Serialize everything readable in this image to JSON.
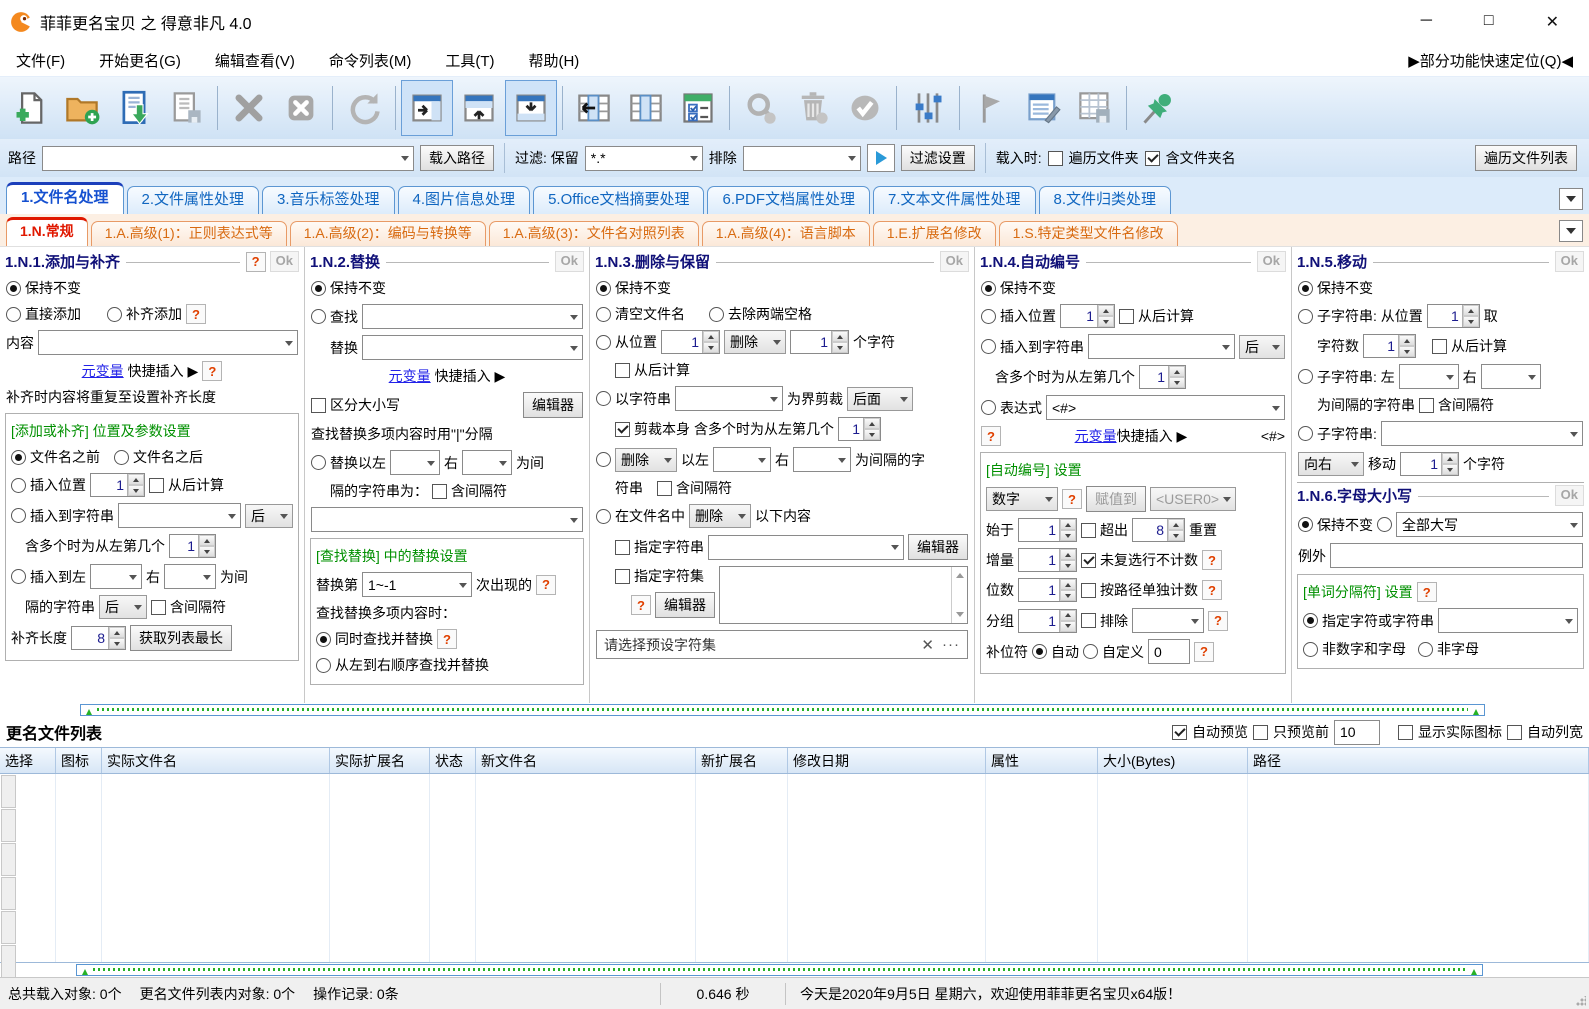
{
  "window": {
    "title": "菲菲更名宝贝 之 得意非凡 4.0",
    "minimize": "─",
    "maximize": "□",
    "close": "✕"
  },
  "menu": {
    "items": [
      "文件(F)",
      "开始更名(G)",
      "编辑查看(V)",
      "命令列表(M)",
      "工具(T)",
      "帮助(H)"
    ],
    "quick_locate": "▶部分功能快速定位(Q)◀"
  },
  "toolbar": {
    "icons": [
      "new-list",
      "add-folder",
      "load-list",
      "save-list",
      "remove",
      "remove-all",
      "refresh",
      "panel-right",
      "panel-top",
      "panel-bottom",
      "move-column-left",
      "column-view",
      "check-options",
      "search",
      "delete",
      "apply",
      "filter-sliders",
      "flag",
      "edit-list",
      "save-table",
      "pin"
    ]
  },
  "pathbar": {
    "path_label": "路径",
    "load_path_button": "载入路径",
    "filter_label": "过滤: 保留",
    "keep_value": "*.*",
    "exclude_label": "排除",
    "filter_settings_button": "过滤设置",
    "load_options_label": "载入时:",
    "traverse_folders": "遍历文件夹",
    "include_folder_names": "含文件夹名",
    "traverse_file_list_button": "遍历文件列表"
  },
  "tabs": {
    "main": [
      {
        "label": "1.文件名处理"
      },
      {
        "label": "2.文件属性处理"
      },
      {
        "label": "3.音乐标签处理"
      },
      {
        "label": "4.图片信息处理"
      },
      {
        "label": "5.Office文档摘要处理"
      },
      {
        "label": "6.PDF文档属性处理"
      },
      {
        "label": "7.文本文件属性处理"
      },
      {
        "label": "8.文件归类处理"
      }
    ],
    "sub": [
      {
        "label": "1.N.常规"
      },
      {
        "label": "1.A.高级(1)：正则表达式等"
      },
      {
        "label": "1.A.高级(2)：编码与转换等"
      },
      {
        "label": "1.A.高级(3)：文件名对照列表"
      },
      {
        "label": "1.A.高级(4)：语言脚本"
      },
      {
        "label": "1.E.扩展名修改"
      },
      {
        "label": "1.S.特定类型文件名修改"
      }
    ]
  },
  "panels": {
    "p1": {
      "title": "1.N.1.添加与补齐",
      "ok": "Ok",
      "keep": "保持不变",
      "direct_add": "直接添加",
      "pad_add": "补齐添加",
      "content_label": "内容",
      "meta_var": "元变量",
      "quick_insert": "快捷插入 ▶",
      "pad_note": "补齐时内容将重复至设置补齐长度",
      "group_title": "[添加或补齐] 位置及参数设置",
      "before_name": "文件名之前",
      "after_name": "文件名之后",
      "insert_pos": "插入位置",
      "pos_value": "1",
      "calc_from_end": "从后计算",
      "insert_to_string": "插入到字符串",
      "after_opt": "后",
      "multi_hint": "含多个时为从左第几个",
      "multi_value": "1",
      "insert_between": "插入到左",
      "right": "右",
      "as_sep": "为间",
      "sep_line2": "隔的字符串",
      "after_opt2": "后",
      "incl_sep": "含间隔符",
      "pad_len": "补齐长度",
      "pad_len_value": "8",
      "get_longest": "获取列表最长"
    },
    "p2": {
      "title": "1.N.2.替换",
      "ok": "Ok",
      "keep": "保持不变",
      "find": "查找",
      "replace": "替换",
      "meta_var": "元变量",
      "quick_insert": "快捷插入 ▶",
      "case_sensitive": "区分大小写",
      "editor": "编辑器",
      "multi_note": "查找替换多项内容时用\"|\"分隔",
      "replace_between": "替换以左",
      "right": "右",
      "as_sep": "为间",
      "sep_line2": "隔的字符串为：",
      "incl_sep": "含间隔符",
      "group_title": "[查找替换] 中的替换设置",
      "replace_nth": "替换第",
      "nth_value": "1~-1",
      "occurrence": "次出现的",
      "multi_mode_label": "查找替换多项内容时：",
      "simultaneous": "同时查找并替换",
      "sequential": "从左到右顺序查找并替换"
    },
    "p3": {
      "title": "1.N.3.删除与保留",
      "ok": "Ok",
      "keep": "保持不变",
      "clear_name": "清空文件名",
      "trim_spaces": "去除两端空格",
      "from_pos": "从位置",
      "pos_value": "1",
      "delete_opt": "删除",
      "count_value": "1",
      "chars_suffix": "个字符",
      "calc_from_end": "从后计算",
      "by_string": "以字符串",
      "crop_label": "为界剪裁",
      "crop_side": "后面",
      "crop_self": "剪裁本身",
      "multi_hint": "含多个时为从左第几个",
      "multi_value": "1",
      "del_between_opt": "删除",
      "between_left": "以左",
      "right": "右",
      "sep_suffix": "为间隔的字",
      "sep_line2": "符串",
      "incl_sep": "含间隔符",
      "in_name": "在文件名中",
      "in_name_opt": "删除",
      "following": "以下内容",
      "spec_string": "指定字符串",
      "editor": "编辑器",
      "spec_charset": "指定字符集",
      "preset_placeholder": "请选择预设字符集",
      "clear_x": "✕",
      "more": "···"
    },
    "p4": {
      "title": "1.N.4.自动编号",
      "ok": "Ok",
      "keep": "保持不变",
      "insert_pos": "插入位置",
      "pos_value": "1",
      "calc_from_end": "从后计算",
      "insert_to_string": "插入到字符串",
      "after_opt": "后",
      "multi_hint": "含多个时为从左第几个",
      "multi_value": "1",
      "expression": "表达式",
      "expr_value": "<#>",
      "meta_var": "元变量",
      "quick_insert": "快捷插入 ▶",
      "expr_tag": "<#>",
      "group_title": "[自动编号] 设置",
      "type_value": "数字",
      "assign_to": "赋值到",
      "assign_target": "<USER0>",
      "start_label": "始于",
      "start_value": "1",
      "over_label": "超出",
      "over_value": "8",
      "reset_label": "重置",
      "incr_label": "增量",
      "incr_value": "1",
      "uncounted": "未复选行不计数",
      "digits_label": "位数",
      "digits_value": "1",
      "per_path": "按路径单独计数",
      "group_label": "分组",
      "group_value": "1",
      "exclude": "排除",
      "pad_label": "补位符",
      "auto": "自动",
      "custom": "自定义",
      "custom_value": "0"
    },
    "p5": {
      "title": "1.N.5.移动",
      "ok": "Ok",
      "keep": "保持不变",
      "sub1": "子字符串: 从位置",
      "pos_value": "1",
      "take": "取",
      "char_count": "字符数",
      "count_value": "1",
      "calc_from_end": "从后计算",
      "sub2": "子字符串: 左",
      "right": "右",
      "sep_line": "为间隔的字符串",
      "incl_sep": "含间隔符",
      "sub3": "子字符串:",
      "dir_value": "向右",
      "move": "移动",
      "move_value": "1",
      "chars_suffix": "个字符"
    },
    "p6": {
      "title": "1.N.6.字母大小写",
      "ok": "Ok",
      "keep": "保持不变",
      "case_value": "全部大写",
      "exception": "例外",
      "group_title": "[单词分隔符] 设置",
      "spec_chars": "指定字符或字符串",
      "non_alnum": "非数字和字母",
      "non_alpha": "非字母"
    }
  },
  "list": {
    "title": "更名文件列表",
    "auto_preview": "自动预览",
    "preview_first": "只预览前",
    "preview_count": "10",
    "show_icons": "显示实际图标",
    "auto_width": "自动列宽",
    "columns": [
      "选择",
      "图标",
      "实际文件名",
      "实际扩展名",
      "状态",
      "新文件名",
      "新扩展名",
      "修改日期",
      "属性",
      "大小(Bytes)",
      "路径"
    ]
  },
  "statusbar": {
    "counts1": "总共载入对象: 0个",
    "counts2": "更名文件列表内对象: 0个",
    "counts3": "操作记录: 0条",
    "time": "0.646 秒",
    "message": "今天是2020年9月5日 星期六，欢迎使用菲菲更名宝贝x64版！"
  }
}
